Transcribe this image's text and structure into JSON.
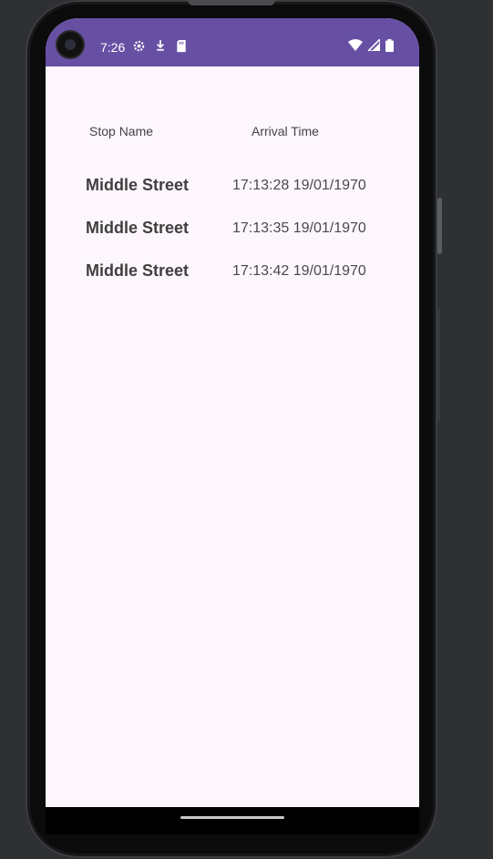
{
  "status_bar": {
    "time": "7:26",
    "icons": [
      "settings-icon",
      "download-icon",
      "sd-card-icon",
      "wifi-icon",
      "signal-icon",
      "battery-icon"
    ],
    "color": "#6750a4"
  },
  "table": {
    "header": {
      "stop_name": "Stop Name",
      "arrival_time": "Arrival Time"
    },
    "rows": [
      {
        "stop_name": "Middle Street",
        "arrival_time": "17:13:28 19/01/1970"
      },
      {
        "stop_name": "Middle Street",
        "arrival_time": "17:13:35 19/01/1970"
      },
      {
        "stop_name": "Middle Street",
        "arrival_time": "17:13:42 19/01/1970"
      }
    ]
  },
  "colors": {
    "background": "#fdf6fd",
    "status_bar": "#6750a4",
    "text_primary": "#3f3f3f"
  }
}
